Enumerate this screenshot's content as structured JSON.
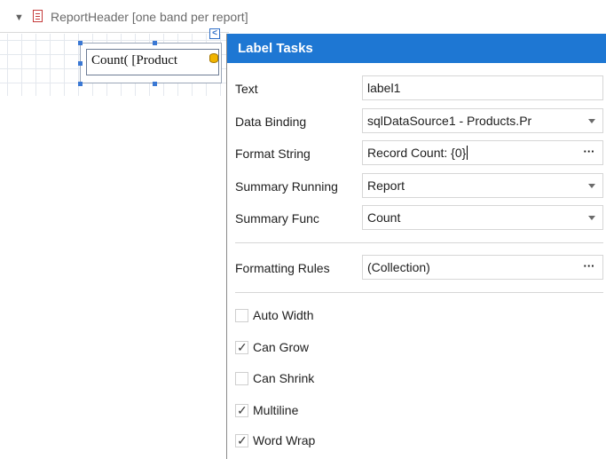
{
  "band": {
    "collapse_icon": "triangle-down-icon",
    "band_icon": "report-header-band-icon",
    "title": "ReportHeader [one band per report]"
  },
  "label_control": {
    "text": "Count( [Product",
    "smart_tag_icon": "chevron-left-icon",
    "binding_icon": "database-binding-icon"
  },
  "panel": {
    "title": "Label Tasks",
    "accent_color": "#1e77d3",
    "rows": {
      "text": {
        "label": "Text",
        "value": "label1"
      },
      "data_binding": {
        "label": "Data Binding",
        "value": "sqlDataSource1 - Products.Pr"
      },
      "format_string": {
        "label": "Format String",
        "value": "Record Count: {0}",
        "button": "···"
      },
      "summary_running": {
        "label": "Summary Running",
        "value": "Report"
      },
      "summary_func": {
        "label": "Summary Func",
        "value": "Count"
      },
      "formatting_rules": {
        "label": "Formatting Rules",
        "value": "(Collection)",
        "button": "···"
      }
    },
    "checkboxes": {
      "auto_width": {
        "label": "Auto Width",
        "checked": false
      },
      "can_grow": {
        "label": "Can Grow",
        "checked": true
      },
      "can_shrink": {
        "label": "Can Shrink",
        "checked": false
      },
      "multiline": {
        "label": "Multiline",
        "checked": true
      },
      "word_wrap": {
        "label": "Word Wrap",
        "checked": true
      }
    },
    "check_mark": "✓"
  }
}
